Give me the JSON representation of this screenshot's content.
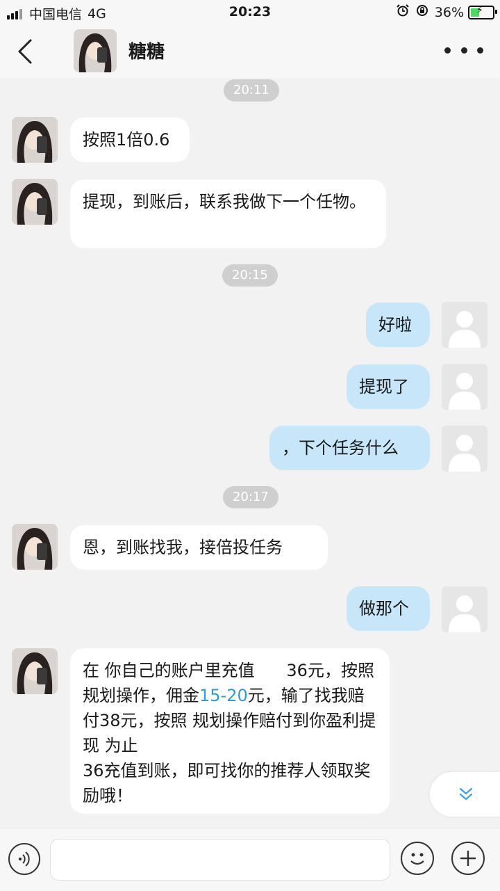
{
  "status_bar": {
    "carrier": "中国电信",
    "network": "4G",
    "time": "20:23",
    "battery": "36%",
    "icons": [
      "signal-icon",
      "alarm-icon",
      "rotation-lock-icon",
      "battery-charging-icon"
    ]
  },
  "header": {
    "title": "糖糖",
    "icons": [
      "back-chevron-icon",
      "avatar",
      "more-dots-icon"
    ]
  },
  "messages": [
    {
      "type": "timestamp",
      "text": "20:11"
    },
    {
      "type": "in",
      "text": "按照1倍0.6"
    },
    {
      "type": "in",
      "text": "提现，到账后，联系我做下一个任物。"
    },
    {
      "type": "timestamp",
      "text": "20:15"
    },
    {
      "type": "out",
      "text": "好啦"
    },
    {
      "type": "out",
      "text": "提现了"
    },
    {
      "type": "out",
      "text": "，下个任务什么"
    },
    {
      "type": "timestamp",
      "text": "20:17"
    },
    {
      "type": "in",
      "text": "恩，到账找我，接倍投任务"
    },
    {
      "type": "out",
      "text": "做那个"
    },
    {
      "type": "in",
      "text_part1": "在 你自己的账户里充值      36元，按照规划操作，佣金",
      "text_highlight": "15-20",
      "text_part2": "元，输了找我赔付38元，按照 规划操作赔付到你盈利提现 为止\n36充值到账，即可找你的推荐人领取奖励哦！"
    }
  ],
  "input_bar": {
    "placeholder": "",
    "icons": [
      "voice-icon",
      "emoji-icon",
      "plus-icon"
    ]
  },
  "colors": {
    "background": "#f2f2f2",
    "incoming_bubble": "#ffffff",
    "outgoing_bubble": "#c8e6f9",
    "timestamp_pill": "#cfcfcf",
    "link_highlight": "#2b9be0"
  }
}
